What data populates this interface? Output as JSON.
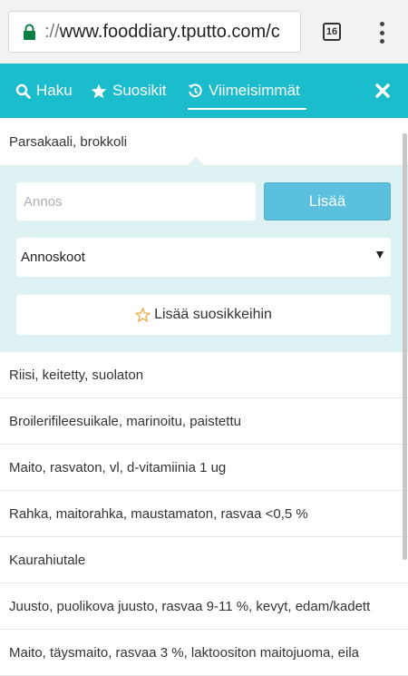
{
  "browser": {
    "url_scheme": "://",
    "url_host": "www.fooddiary.tputto.com/c",
    "tab_count": "16",
    "lock_color": "#0b8043"
  },
  "nav": {
    "color": "#1bbccb",
    "items": [
      {
        "label": "Haku",
        "icon": "search-icon"
      },
      {
        "label": "Suosikit",
        "icon": "star-icon"
      },
      {
        "label": "Viimeisimmät",
        "icon": "history-icon",
        "active": true
      }
    ],
    "close_icon": "close-icon"
  },
  "selected_item": "Parsakaali, brokkoli",
  "panel": {
    "portion_placeholder": "Annos",
    "add_label": "Lisää",
    "sizes_label": "Annoskoot",
    "favorite_label": "Lisää suosikkeihin",
    "favorite_icon": "star-outline-icon",
    "favorite_icon_color": "#f0ad4e",
    "add_color": "#5bc0de"
  },
  "items": [
    "Riisi, keitetty, suolaton",
    "Broilerifileesuikale, marinoitu, paistettu",
    "Maito, rasvaton, vl, d-vitamiinia 1 ug",
    "Rahka, maitorahka, maustamaton, rasvaa <0,5 %",
    "Kaurahiutale",
    "Juusto, puolikova juusto, rasvaa 9-11 %, kevyt, edam/kadett",
    "Maito, täysmaito, rasvaa 3 %, laktoositon maitojuoma, eila"
  ]
}
